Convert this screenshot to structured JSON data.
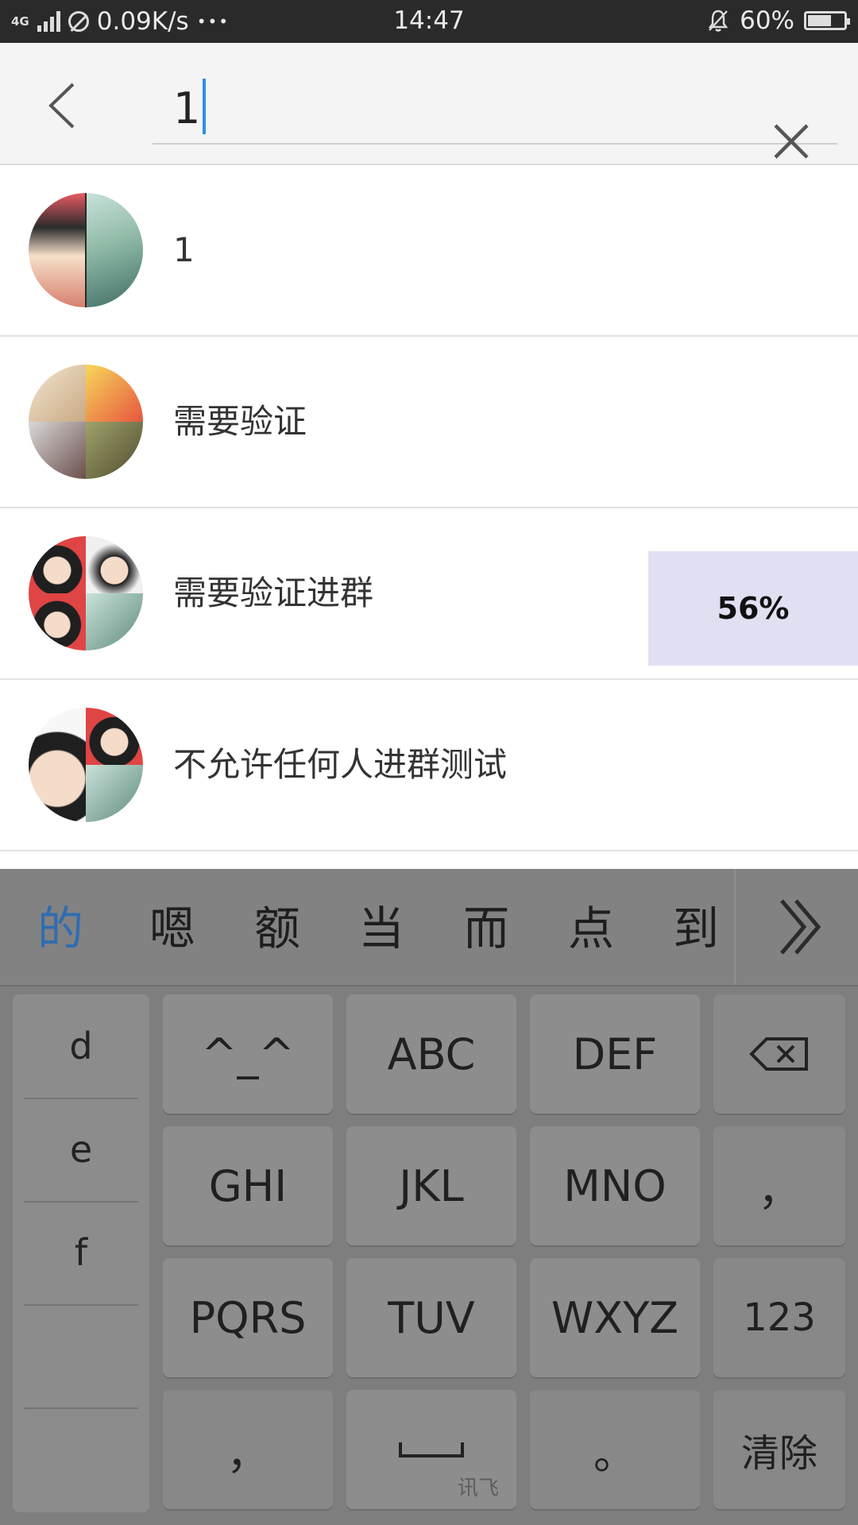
{
  "status_bar": {
    "network": "4G",
    "network2": "4G",
    "speed": "0.09K/s",
    "dots": "•••",
    "time": "14:47",
    "battery": "60%",
    "battery_level": 0.6
  },
  "search": {
    "value": "1"
  },
  "results": [
    {
      "name": "1"
    },
    {
      "name": "需要验证"
    },
    {
      "name": "需要验证进群",
      "progress": "56%"
    },
    {
      "name": "不允许任何人进群测试"
    }
  ],
  "ime": {
    "candidates": [
      "的",
      "嗯",
      "额",
      "当",
      "而",
      "点",
      "到"
    ],
    "left_column": [
      "d",
      "e",
      "f"
    ],
    "keys": {
      "emoticon": "^_^",
      "abc": "ABC",
      "def": "DEF",
      "ghi": "GHI",
      "jkl": "JKL",
      "mno": "MNO",
      "comma_right": "，",
      "pqrs": "PQRS",
      "tuv": "TUV",
      "wxyz": "WXYZ",
      "num": "123",
      "comma_bottom": "，",
      "space_brand": "讯飞",
      "period": "。",
      "clear": "清除"
    }
  },
  "colors": {
    "accent": "#2d8fe8",
    "progress_bg": "#e1e0f3",
    "candidate_active": "#2f6db1"
  }
}
